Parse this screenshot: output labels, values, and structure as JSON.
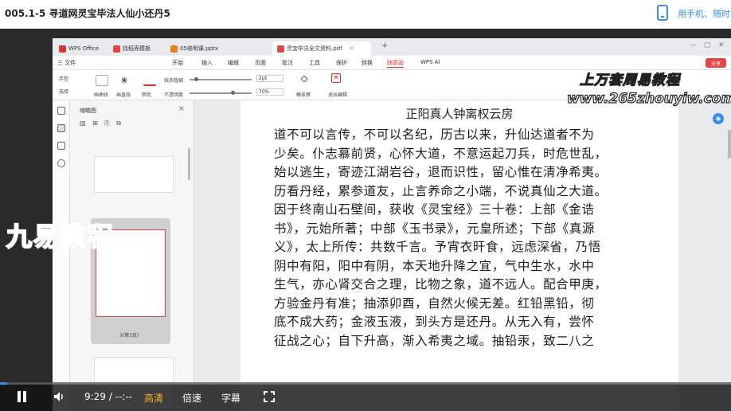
{
  "page": {
    "title": "005.1-5 寻道网灵宝毕法人仙小还丹5",
    "phone_link": "用手机、随时"
  },
  "wps": {
    "tabs": [
      {
        "label": "WPS Office",
        "color": "#d9382e"
      },
      {
        "label": "找稻壳模板",
        "color": "#e64545"
      },
      {
        "label": "05修明课.pptx",
        "color": "#e67e22"
      },
      {
        "label": "灵宝毕法全文资料.pdf",
        "color": "#e64545"
      }
    ],
    "menu": [
      "三 文件",
      "开始",
      "插入",
      "编辑",
      "页面",
      "批注",
      "工具",
      "保护",
      "转换",
      "随意画",
      "WPS AI"
    ],
    "active_menu": "随意画",
    "share_label": "分享",
    "ribbon": {
      "hand": "手型",
      "select": "选择",
      "draw_curve": "画曲线",
      "draw_line": "画直线",
      "color": "颜色",
      "opacity": "不透明度",
      "line_width": "线条粗细",
      "width_value": "2pt",
      "opacity_value": "70%",
      "eraser": "橡皮擦",
      "exit": "退出编辑"
    },
    "sidebar": {
      "title": "缩略图",
      "close": "×",
      "page_label_3": "3(第3页)"
    },
    "document": {
      "title": "正阳真人钟离权云房",
      "lines": [
        "道不可以言传，不可以名纪，历古以来，升仙达道者不为",
        "少矣。仆志慕前贤，心怀大道，不意运起刀兵，时危世乱，",
        "始以逃生，寄迹江湖岩谷，退而识性，留心惟在清净希夷。",
        "历看丹经，累参道友，止言养命之小端，不说真仙之大道。",
        "因于终南山石壁间，获收《灵宝经》三十卷：上部《金诰",
        "书》，元始所著；中部《玉书录》，元皇所述；下部《真源",
        "义》，太上所传：共数千言。予宵衣旰食，远虑深省，乃悟",
        "阴中有阳，阳中有阴，本天地升降之宜，气中生水，水中",
        "生气，亦心肾交合之理，比物之象，道不远人。配合甲庚，",
        "方验金丹有准；抽添卯酉，自然火候无差。红铅黑铅，彻",
        "底不成大药；金液玉液，到头方是还丹。从无入有，尝怀",
        "征战之心；自下升高，渐入希夷之域。抽铅汞，致二八之"
      ]
    }
  },
  "watermark": {
    "top": "上万套周易教程",
    "url": "www.265zhouyiw.com",
    "logo": "九易教程"
  },
  "player": {
    "time": "9:29 / --:--",
    "quality": "高清",
    "speed": "倍速",
    "subtitle": "字幕",
    "progress": 0.01
  }
}
